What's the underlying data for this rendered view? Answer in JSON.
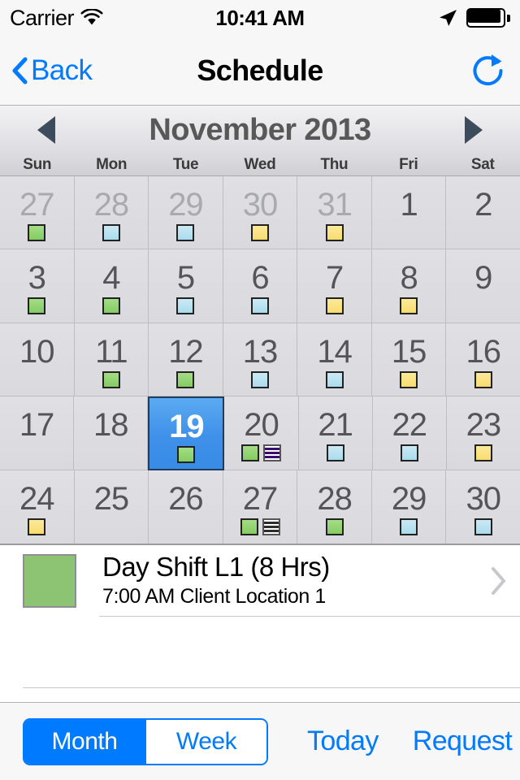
{
  "status_bar": {
    "carrier": "Carrier",
    "time": "10:41 AM",
    "wifi_icon": "wifi-icon",
    "location_icon": "location-arrow-icon",
    "battery_icon": "battery-full-icon"
  },
  "nav_bar": {
    "back_label": "Back",
    "back_icon": "chevron-left-icon",
    "title": "Schedule",
    "refresh_icon": "refresh-icon"
  },
  "month_header": {
    "title": "November 2013",
    "prev_icon": "triangle-left-icon",
    "next_icon": "triangle-right-icon"
  },
  "weekdays": [
    "Sun",
    "Mon",
    "Tue",
    "Wed",
    "Thu",
    "Fri",
    "Sat"
  ],
  "calendar": {
    "selected_day": "19",
    "rows": [
      [
        {
          "day": "27",
          "other_month": true,
          "selected": false,
          "markers": [
            "green"
          ]
        },
        {
          "day": "28",
          "other_month": true,
          "selected": false,
          "markers": [
            "blue"
          ]
        },
        {
          "day": "29",
          "other_month": true,
          "selected": false,
          "markers": [
            "blue"
          ]
        },
        {
          "day": "30",
          "other_month": true,
          "selected": false,
          "markers": [
            "yellow"
          ]
        },
        {
          "day": "31",
          "other_month": true,
          "selected": false,
          "markers": [
            "yellow"
          ]
        },
        {
          "day": "1",
          "other_month": false,
          "selected": false,
          "markers": []
        },
        {
          "day": "2",
          "other_month": false,
          "selected": false,
          "markers": []
        }
      ],
      [
        {
          "day": "3",
          "other_month": false,
          "selected": false,
          "markers": [
            "green"
          ]
        },
        {
          "day": "4",
          "other_month": false,
          "selected": false,
          "markers": [
            "green"
          ]
        },
        {
          "day": "5",
          "other_month": false,
          "selected": false,
          "markers": [
            "blue"
          ]
        },
        {
          "day": "6",
          "other_month": false,
          "selected": false,
          "markers": [
            "blue"
          ]
        },
        {
          "day": "7",
          "other_month": false,
          "selected": false,
          "markers": [
            "yellow"
          ]
        },
        {
          "day": "8",
          "other_month": false,
          "selected": false,
          "markers": [
            "yellow"
          ]
        },
        {
          "day": "9",
          "other_month": false,
          "selected": false,
          "markers": []
        }
      ],
      [
        {
          "day": "10",
          "other_month": false,
          "selected": false,
          "markers": []
        },
        {
          "day": "11",
          "other_month": false,
          "selected": false,
          "markers": [
            "green"
          ]
        },
        {
          "day": "12",
          "other_month": false,
          "selected": false,
          "markers": [
            "green"
          ]
        },
        {
          "day": "13",
          "other_month": false,
          "selected": false,
          "markers": [
            "blue"
          ]
        },
        {
          "day": "14",
          "other_month": false,
          "selected": false,
          "markers": [
            "blue"
          ]
        },
        {
          "day": "15",
          "other_month": false,
          "selected": false,
          "markers": [
            "yellow"
          ]
        },
        {
          "day": "16",
          "other_month": false,
          "selected": false,
          "markers": [
            "yellow"
          ]
        }
      ],
      [
        {
          "day": "17",
          "other_month": false,
          "selected": false,
          "markers": []
        },
        {
          "day": "18",
          "other_month": false,
          "selected": false,
          "markers": []
        },
        {
          "day": "19",
          "other_month": false,
          "selected": true,
          "markers": [
            "green"
          ]
        },
        {
          "day": "20",
          "other_month": false,
          "selected": false,
          "markers": [
            "green",
            "purple-striped"
          ]
        },
        {
          "day": "21",
          "other_month": false,
          "selected": false,
          "markers": [
            "blue"
          ]
        },
        {
          "day": "22",
          "other_month": false,
          "selected": false,
          "markers": [
            "blue"
          ]
        },
        {
          "day": "23",
          "other_month": false,
          "selected": false,
          "markers": [
            "yellow"
          ]
        }
      ],
      [
        {
          "day": "24",
          "other_month": false,
          "selected": false,
          "markers": [
            "yellow"
          ]
        },
        {
          "day": "25",
          "other_month": false,
          "selected": false,
          "markers": []
        },
        {
          "day": "26",
          "other_month": false,
          "selected": false,
          "markers": []
        },
        {
          "day": "27",
          "other_month": false,
          "selected": false,
          "markers": [
            "green",
            "gray-striped"
          ]
        },
        {
          "day": "28",
          "other_month": false,
          "selected": false,
          "markers": [
            "green"
          ]
        },
        {
          "day": "29",
          "other_month": false,
          "selected": false,
          "markers": [
            "blue"
          ]
        },
        {
          "day": "30",
          "other_month": false,
          "selected": false,
          "markers": [
            "blue"
          ]
        }
      ]
    ]
  },
  "events": [
    {
      "title": "Day Shift L1 (8 Hrs)",
      "subtitle": "7:00 AM Client Location 1",
      "color": "#8cc474",
      "chevron_icon": "chevron-right-icon"
    }
  ],
  "toolbar": {
    "segments": [
      {
        "label": "Month",
        "active": true
      },
      {
        "label": "Week",
        "active": false
      }
    ],
    "today_label": "Today",
    "request_label": "Request"
  },
  "colors": {
    "accent": "#007aff",
    "marker_green": "#84cc62",
    "marker_blue": "#a9dced",
    "marker_yellow": "#f8dc6e",
    "marker_purple": "#3a0d6b",
    "selected_day_bg": "#3f90e8"
  }
}
